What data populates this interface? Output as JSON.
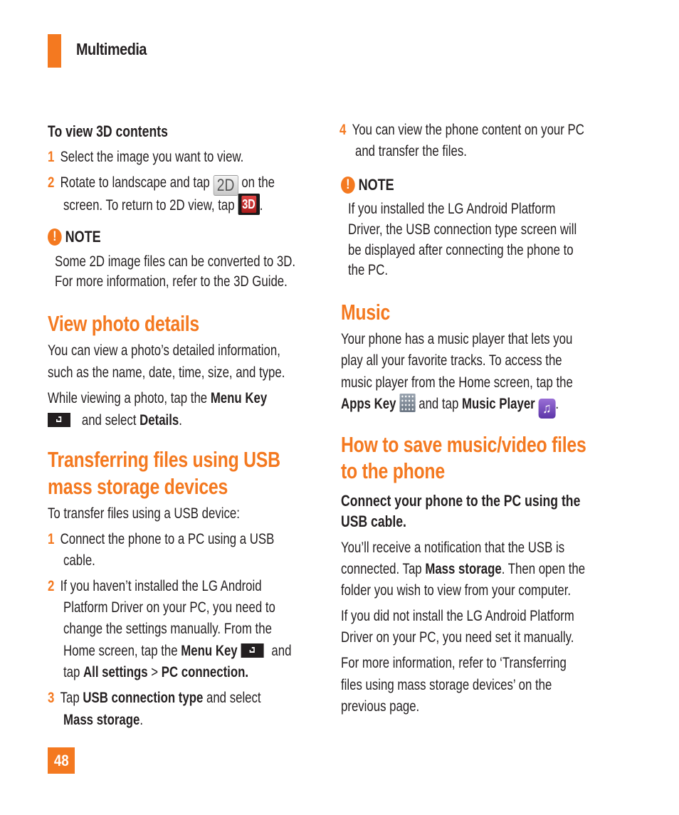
{
  "header": {
    "section_title": "Multimedia",
    "accent_color": "#f47920"
  },
  "left": {
    "view3d": {
      "title": "To view 3D contents",
      "steps": [
        {
          "num": "1",
          "text": "Select the image you want to view."
        },
        {
          "num": "2",
          "line1_pre": "Rotate to landscape and tap",
          "icon_2d_label": "2D",
          "line1_post": "on the",
          "line2_pre": "screen. To return to 2D view, tap",
          "icon_3d_label": "3D",
          "line2_post": "."
        }
      ],
      "note": {
        "icon": "exclamation-icon",
        "label": "NOTE",
        "lines": [
          "Some 2D image files can be converted to 3D.",
          "For more information, refer to the 3D Guide."
        ]
      }
    },
    "photo_details": {
      "title": "View photo details",
      "para1": [
        "You can view a photo’s detailed information,",
        "such as the name, date, time, size, and type."
      ],
      "para2_pre": "While viewing a photo, tap the",
      "para2_bold1": "Menu Key",
      "para2_mid": "and select",
      "para2_bold2": "Details",
      "para2_end": "."
    },
    "transfer": {
      "title_lines": [
        "Transferring files using USB",
        "mass storage devices"
      ],
      "intro": "To transfer files using a USB device:",
      "step1": {
        "num": "1",
        "lines": [
          "Connect the phone to a PC using a USB",
          "cable."
        ]
      },
      "step2": {
        "num": "2",
        "lines": [
          "If you haven’t installed the LG Android",
          "Platform Driver on your PC, you need to",
          "change the settings manually. From the"
        ],
        "line4_pre": "Home screen, tap the",
        "line4_bold": "Menu Key",
        "line4_post": "and",
        "line5_pre": "tap",
        "line5_bold1": "All settings",
        "line5_sep": ">",
        "line5_bold2": "PC connection."
      },
      "step3": {
        "num": "3",
        "pre": "Tap",
        "bold1": "USB connection type",
        "mid": "and select",
        "bold2": "Mass storage",
        "end": "."
      }
    }
  },
  "right": {
    "step4": {
      "num": "4",
      "lines": [
        "You can view the phone content on your PC",
        "and transfer the files."
      ]
    },
    "note": {
      "icon": "exclamation-icon",
      "label": "NOTE",
      "lines": [
        "If you installed the LG Android Platform",
        "Driver, the USB connection type screen will",
        "be displayed after connecting the phone to",
        "the PC."
      ]
    },
    "music": {
      "title": "Music",
      "lines": [
        "Your phone has a music player that lets you",
        "play all your favorite tracks. To access the",
        "music player from the Home screen, tap the"
      ],
      "last_bold1": "Apps Key",
      "last_mid": "and tap",
      "last_bold2": "Music Player",
      "last_end": "."
    },
    "save_files": {
      "title_lines": [
        "How to save music/video files",
        "to the phone"
      ],
      "subhead_lines": [
        "Connect your phone to the PC using the",
        "USB cable."
      ],
      "para1_line1": "You’ll receive a notification that the USB is",
      "para1_line2_pre": "connected. Tap",
      "para1_line2_bold": "Mass storage",
      "para1_line2_post": ". Then open the",
      "para1_line3": "folder you wish to view from your computer.",
      "para2": [
        "If you did not install the LG Android Platform",
        "Driver on your PC, you need set it manually."
      ],
      "para3": [
        "For more information, refer to ‘Transferring",
        "files using mass storage devices’ on the",
        "previous page."
      ]
    }
  },
  "footer": {
    "page_number": "48"
  }
}
